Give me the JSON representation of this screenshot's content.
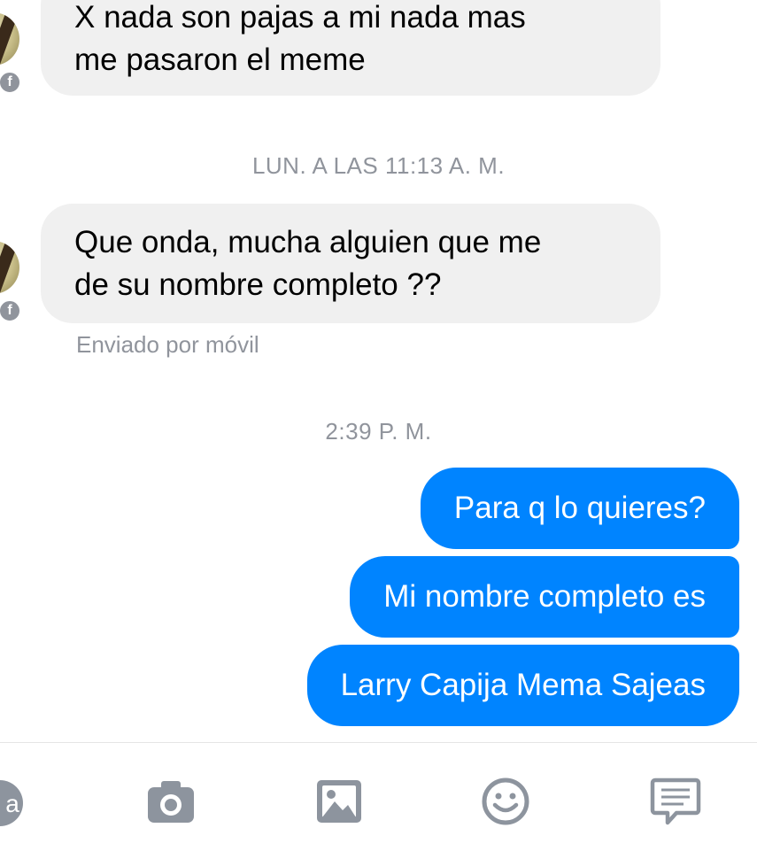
{
  "messages": {
    "incoming_1": {
      "lines": [
        "X nada son pajas a mi nada mas",
        "me pasaron el meme"
      ]
    },
    "timestamp_1": "LUN. A LAS 11:13 A. M.",
    "incoming_2": {
      "lines": [
        "Que onda, mucha alguien que me",
        "de su nombre completo ??"
      ]
    },
    "sent_from": "Enviado por móvil",
    "timestamp_2": "2:39 P. M.",
    "outgoing": [
      "Para q lo quieres?",
      "Mi nombre completo es",
      "Larry Capija Mema Sajeas"
    ]
  },
  "toolbar": {
    "text_button_label": "a",
    "icons": [
      "text-format-icon",
      "camera-icon",
      "image-icon",
      "emoji-icon",
      "more-icon"
    ]
  },
  "colors": {
    "outgoing_bubble": "#0084ff",
    "incoming_bubble": "#f0f0f0",
    "meta_text": "#90949c",
    "toolbar_icon": "#8d949e"
  }
}
